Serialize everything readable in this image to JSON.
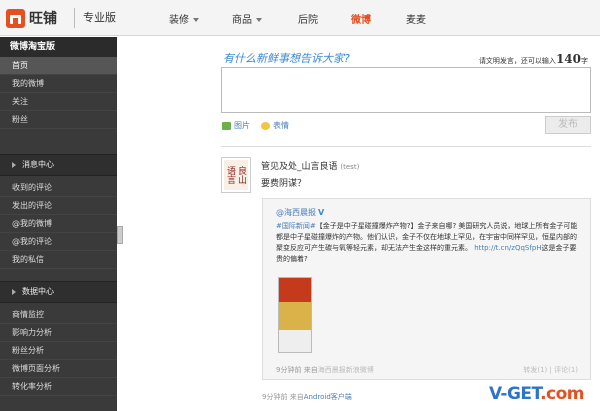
{
  "header": {
    "brand": "旺铺",
    "edition": "专业版",
    "nav": [
      {
        "label": "装修",
        "dropdown": true,
        "active": false
      },
      {
        "label": "商品",
        "dropdown": true,
        "active": false
      },
      {
        "label": "后院",
        "dropdown": false,
        "active": false
      },
      {
        "label": "微博",
        "dropdown": false,
        "active": true
      },
      {
        "label": "麦麦",
        "dropdown": false,
        "active": false
      }
    ]
  },
  "sidebar": {
    "title": "微博淘宝版",
    "items": [
      "首页",
      "我的微博",
      "关注",
      "粉丝"
    ],
    "sections": [
      {
        "label": "消息中心",
        "items": [
          "收到的评论",
          "发出的评论",
          "@我的微博",
          "@我的评论",
          "我的私信"
        ]
      },
      {
        "label": "数据中心",
        "items": [
          "商情监控",
          "影响力分析",
          "粉丝分析",
          "微博页面分析",
          "转化率分析"
        ]
      }
    ]
  },
  "composer": {
    "prompt": "有什么新鲜事想告诉大家?",
    "hint_prefix": "请文明发言，还可以输入",
    "remaining": "140",
    "hint_suffix": "字",
    "picture_label": "图片",
    "emoji_label": "表情",
    "publish_label": "发布"
  },
  "post": {
    "author": "管见及处_山言良语",
    "tag": "(test)",
    "text": "要费阴谋？",
    "avatar_text": "良山语言",
    "time": "9分钟前",
    "via_prefix": "来自",
    "source": "Android客户端",
    "repost": {
      "author": "@海西晨报",
      "topic": "#国际新闻#",
      "body": "【金子是中子星碰撞爆炸产物?】金子来自哪? 美国研究人员说，地球上所有金子可能都是中子星碰撞爆炸的产物。他们认识，金子不仅在地球上罕见，在宇宙中同样罕见，恒星内部的聚变反应可产生碳与氧等轻元素，却无法产生金这样的重元素。",
      "link": "http://t.cn/zQqSfpH",
      "tail": "这是金子要贵的偏着?",
      "time": "9分钟前",
      "via_prefix": "来自",
      "source": "海西晨报新浪微博",
      "actions": "转发(1) | 评论(1)"
    }
  },
  "watermark": {
    "main": "V-GET",
    "suffix": ".com"
  },
  "colors": {
    "accent": "#e55022",
    "link": "#4a7fb8",
    "sidebar": "#3a3a3a"
  }
}
